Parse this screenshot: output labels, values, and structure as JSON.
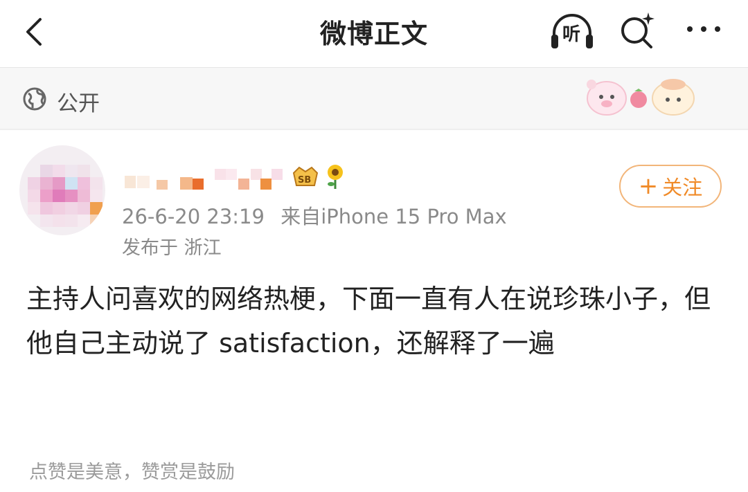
{
  "header": {
    "title": "微博正文",
    "listen_label": "听",
    "back_icon": "chevron-left-icon",
    "search_icon": "search-sparkle-icon",
    "more_icon": "more-dots-icon"
  },
  "visibility": {
    "label": "公开",
    "icon": "globe-icon"
  },
  "post": {
    "timestamp": "26-6-20 23:19",
    "source_prefix": "来自",
    "device": "iPhone 15 Pro Max",
    "location": "发布于 浙江",
    "follow_label": "关注",
    "content": "主持人问喜欢的网络热梗，下面一直有人在说珍珠小子，但他自己主动说了 satisfaction，还解释了一遍"
  },
  "footer": {
    "hint": "点赞是美意，赞赏是鼓励"
  },
  "colors": {
    "accent_orange": "#f08a27",
    "follow_border": "#f2b579",
    "meta_gray": "#8a8a8a"
  }
}
